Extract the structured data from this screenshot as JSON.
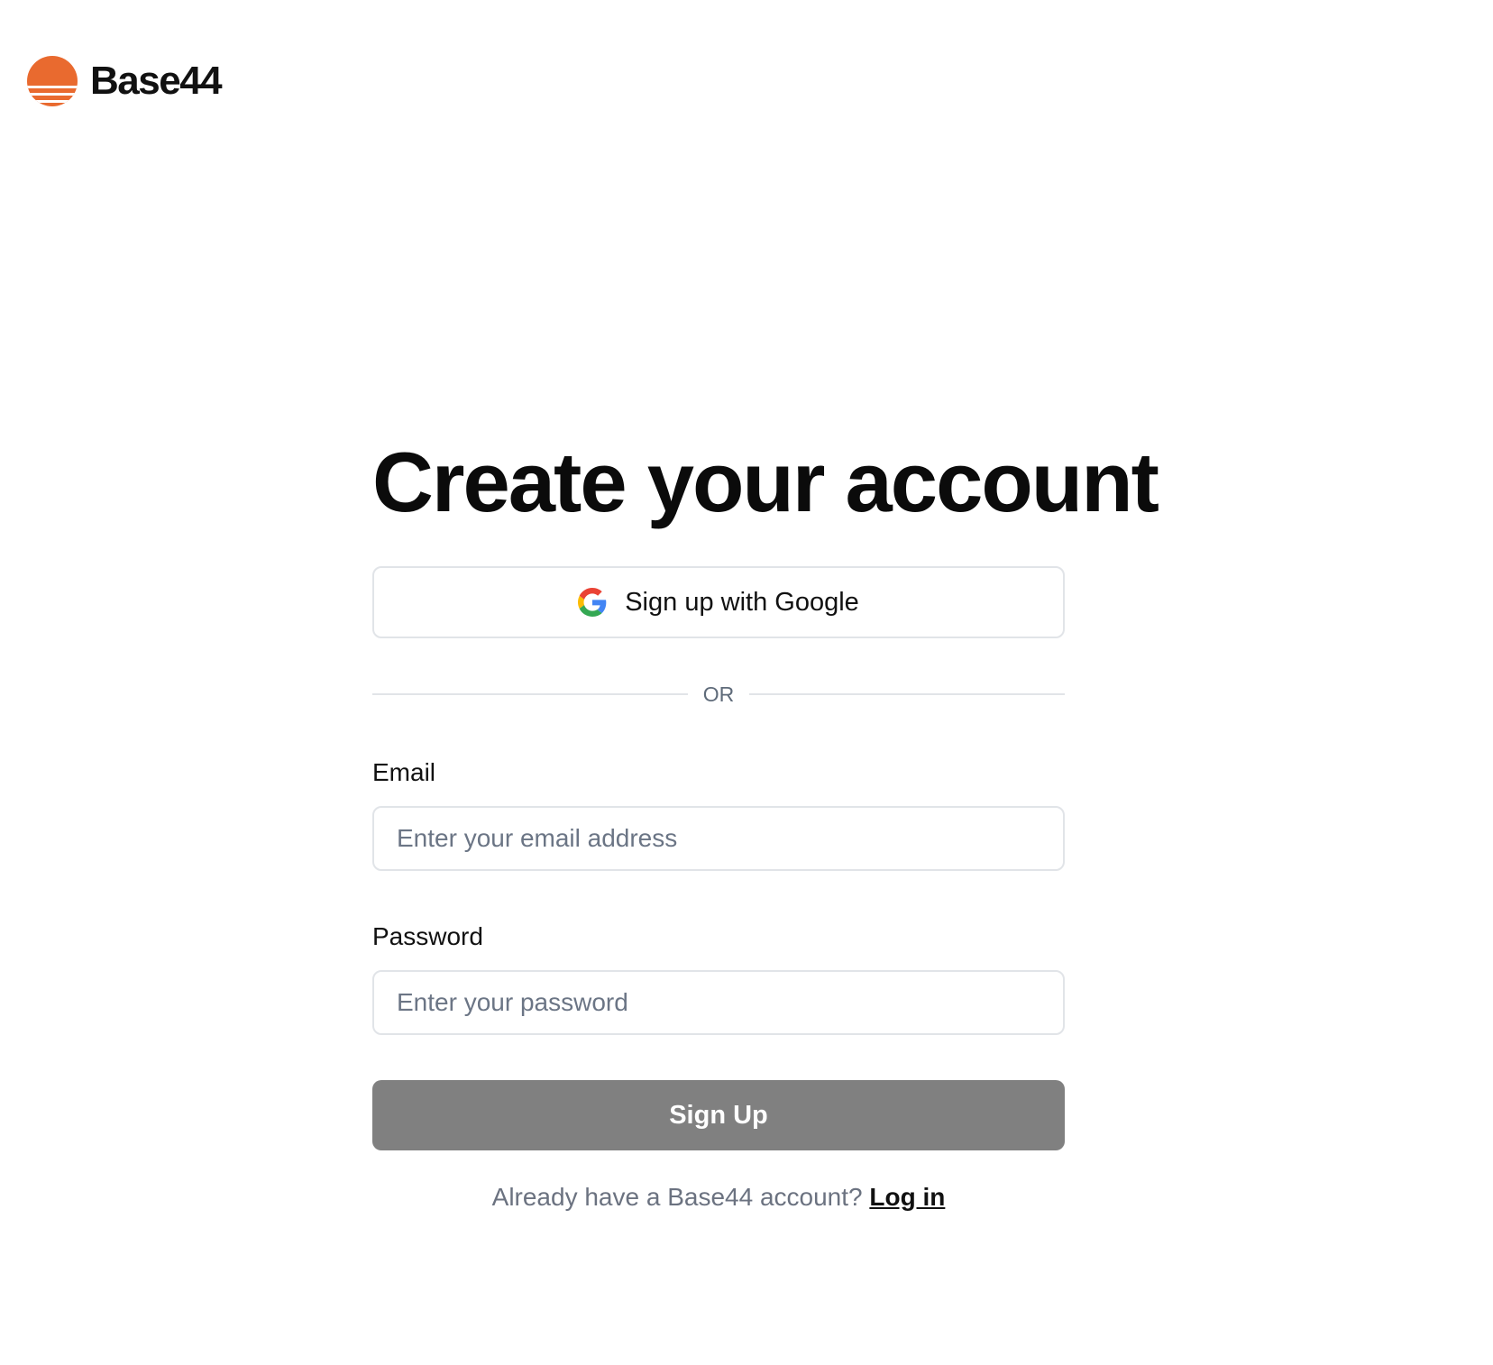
{
  "brand": {
    "name": "Base44",
    "logo_icon": "sun-logo-icon",
    "logo_color": "#E96A2F"
  },
  "form": {
    "title": "Create your account",
    "google_button": {
      "label": "Sign up with Google",
      "icon": "google-icon"
    },
    "divider_text": "OR",
    "email": {
      "label": "Email",
      "placeholder": "Enter your email address",
      "value": ""
    },
    "password": {
      "label": "Password",
      "placeholder": "Enter your password",
      "value": ""
    },
    "submit_label": "Sign Up",
    "submit_color": "#808080",
    "footer": {
      "prompt": "Already have a Base44 account?",
      "link_label": "Log in"
    }
  }
}
